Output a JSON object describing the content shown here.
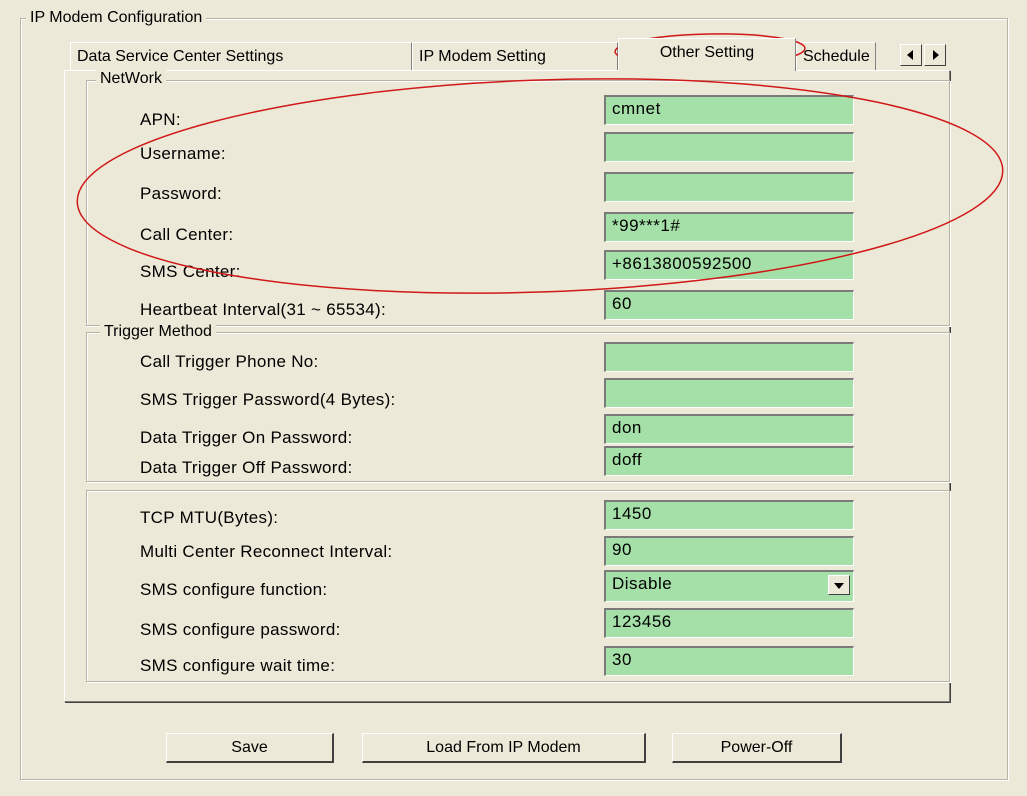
{
  "group": {
    "title": "IP Modem Configuration"
  },
  "tabs": [
    {
      "label": "Data Service Center Settings"
    },
    {
      "label": "IP Modem Setting"
    },
    {
      "label": "Other Setting"
    },
    {
      "label": "Schedule"
    }
  ],
  "network": {
    "title": "NetWork",
    "fields": [
      {
        "label": "APN:",
        "value": "cmnet"
      },
      {
        "label": "Username:",
        "value": ""
      },
      {
        "label": "Password:",
        "value": ""
      },
      {
        "label": "Call Center:",
        "value": "*99***1#"
      },
      {
        "label": "SMS Center:",
        "value": "+8613800592500"
      },
      {
        "label": "Heartbeat Interval(31 ~ 65534):",
        "value": "60"
      }
    ]
  },
  "trigger": {
    "title": "Trigger Method",
    "fields": [
      {
        "label": "Call Trigger Phone No:",
        "value": ""
      },
      {
        "label": "SMS Trigger Password(4 Bytes):",
        "value": ""
      },
      {
        "label": "Data Trigger On Password:",
        "value": "don"
      },
      {
        "label": "Data Trigger Off Password:",
        "value": "doff"
      }
    ]
  },
  "misc": {
    "fields": [
      {
        "label": "TCP MTU(Bytes):",
        "value": "1450"
      },
      {
        "label": "Multi Center Reconnect Interval:",
        "value": "90"
      },
      {
        "label": "SMS configure function:",
        "value": "Disable"
      },
      {
        "label": "SMS configure password:",
        "value": "123456"
      },
      {
        "label": "SMS configure wait time:",
        "value": "30"
      }
    ]
  },
  "buttons": {
    "save": "Save",
    "load": "Load From IP Modem",
    "power": "Power-Off"
  },
  "colors": {
    "field_bg": "#a5e0a8",
    "window_bg": "#ece9d8",
    "annotation": "#d01818"
  },
  "icons": {
    "scroll_left": "triangle-left-icon",
    "scroll_right": "triangle-right-icon",
    "dropdown": "chevron-down-icon"
  }
}
